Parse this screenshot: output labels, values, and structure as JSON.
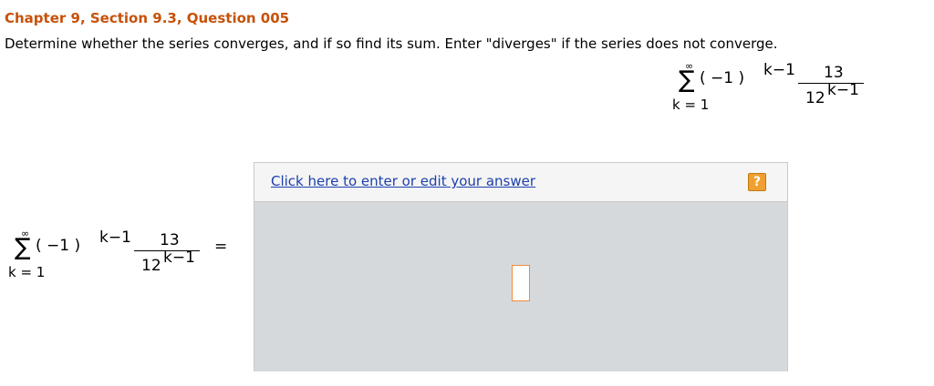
{
  "question": {
    "title": "Chapter 9, Section 9.3, Question 005",
    "prompt": "Determine whether the series converges, and if so find its sum. Enter \"diverges\" if the series does not converge."
  },
  "series": {
    "upper_limit": "∞",
    "sigma": "∑",
    "lower_limit": "k = 1",
    "term_base": "( −1 )",
    "term_exponent": "k−1",
    "numerator": "13",
    "denominator_base": "12",
    "denominator_exponent": "k−1",
    "equals": "="
  },
  "answer": {
    "link_text": "Click here to enter or edit your answer",
    "help_icon": "question-mark-icon",
    "help_glyph": "?",
    "value": ""
  },
  "colors": {
    "title": "#c6520a",
    "link": "#1b3fae",
    "help_icon_bg": "#f0a030",
    "panel_bg": "#d6d9dc",
    "answer_box_border": "#f08a3a"
  }
}
